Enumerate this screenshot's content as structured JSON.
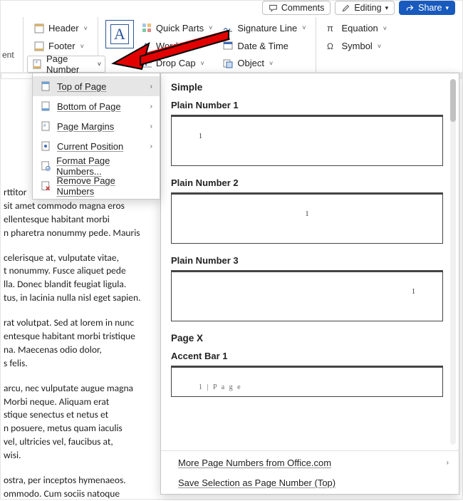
{
  "titlebar": {
    "comments": "Comments",
    "editing": "Editing",
    "share": "Share"
  },
  "ribbon": {
    "ent_fragment": "ent",
    "header": "Header",
    "footer": "Footer",
    "page_number": "Page Number",
    "quick_parts": "Quick Parts",
    "wordart": "WordArt",
    "drop_cap": "Drop Cap",
    "signature_line": "Signature Line",
    "date_time": "Date & Time",
    "object": "Object",
    "equation": "Equation",
    "symbol": "Symbol"
  },
  "menu": {
    "top": "Top of Page",
    "bottom": "Bottom of Page",
    "margins": "Page Margins",
    "current": "Current Position",
    "format": "Format Page Numbers...",
    "remove": "Remove Page Numbers"
  },
  "gallery": {
    "section1": "Simple",
    "p1": "Plain Number 1",
    "p2": "Plain Number 2",
    "p3": "Plain Number 3",
    "section2": "Page X",
    "accent1": "Accent Bar 1",
    "sample_digit": "1",
    "accent_text": "1 | P a g e",
    "more": "More Page Numbers from Office.com",
    "save": "Save Selection as Page Number (Top)"
  },
  "doc": {
    "l0": "rttitor",
    "l1": "sit amet commodo magna eros",
    "l2": "ellentesque habitant morbi",
    "l3": "n pharetra nonummy pede. Mauris",
    "p2": "celerisque at, vulputate vitae,\nt nonummy. Fusce aliquet pede\nlla. Donec blandit feugiat ligula.\ntus, in lacinia nulla nisl eget sapien.",
    "p3": "rat volutpat. Sed at lorem in nunc\nentesque habitant morbi tristique\nna. Maecenas odio dolor,\ns felis.",
    "p4": "arcu, nec vulputate augue magna\nMorbi neque. Aliquam erat\nstique senectus et netus et\nn posuere, metus quam iaculis\nvel, ultricies vel, faucibus at,\nwisi.",
    "p5": "ostra, per inceptos hymenaeos.\nommodo. Cum sociis natoque"
  }
}
